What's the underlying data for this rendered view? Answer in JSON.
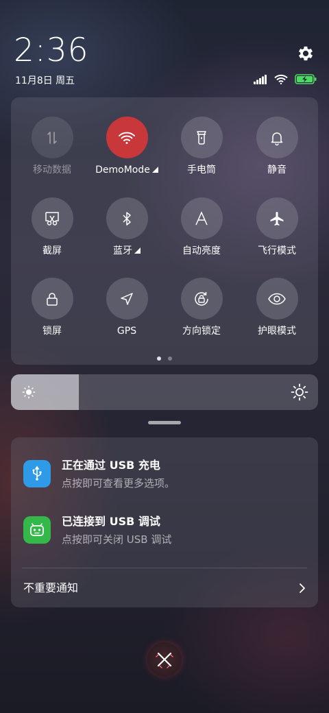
{
  "status_bar": {
    "time": "2:36",
    "date": "11月8日 周五",
    "battery_color": "#4cd964"
  },
  "quick_settings": {
    "tiles": [
      {
        "label": "移动数据",
        "icon": "mobile-data-icon",
        "state": "disabled"
      },
      {
        "label": "DemoMode",
        "icon": "wifi-icon",
        "state": "active",
        "has_menu": true
      },
      {
        "label": "手电筒",
        "icon": "flashlight-icon",
        "state": "off"
      },
      {
        "label": "静音",
        "icon": "bell-icon",
        "state": "off"
      },
      {
        "label": "截屏",
        "icon": "screenshot-icon",
        "state": "off"
      },
      {
        "label": "蓝牙",
        "icon": "bluetooth-icon",
        "state": "off",
        "has_menu": true
      },
      {
        "label": "自动亮度",
        "icon": "auto-brightness-icon",
        "state": "off"
      },
      {
        "label": "飞行模式",
        "icon": "airplane-icon",
        "state": "off"
      },
      {
        "label": "锁屏",
        "icon": "lock-icon",
        "state": "off"
      },
      {
        "label": "GPS",
        "icon": "location-icon",
        "state": "off"
      },
      {
        "label": "方向锁定",
        "icon": "rotation-lock-icon",
        "state": "off"
      },
      {
        "label": "护眼模式",
        "icon": "eye-icon",
        "state": "off"
      }
    ],
    "page_count": 2,
    "current_page": 1,
    "active_color": "#c8373a"
  },
  "brightness": {
    "level": 0.22
  },
  "notifications": {
    "items": [
      {
        "title": "正在通过 USB 充电",
        "subtitle": "点按即可查看更多选项。",
        "icon": "usb-icon",
        "icon_color": "#2f9be8"
      },
      {
        "title": "已连接到 USB 调试",
        "subtitle": "点按即可关闭 USB 调试",
        "icon": "android-icon",
        "icon_color": "#35b84a"
      }
    ],
    "unimportant_label": "不重要通知"
  }
}
